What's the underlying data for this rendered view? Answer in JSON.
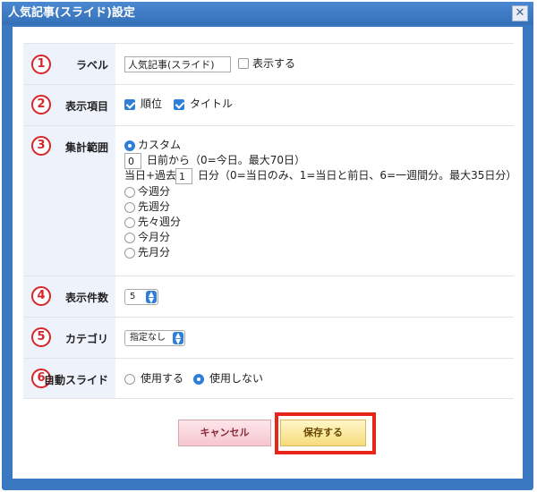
{
  "dialog": {
    "title": "人気記事(スライド)設定",
    "close_glyph": "✕"
  },
  "rows": {
    "label": {
      "num": "1",
      "label": "ラベル",
      "input_value": "人気記事(スライド)",
      "show_label": "表示する",
      "show_checked": false
    },
    "display_items": {
      "num": "2",
      "label": "表示項目",
      "options": [
        {
          "label": "順位",
          "checked": true
        },
        {
          "label": "タイトル",
          "checked": true
        }
      ]
    },
    "range": {
      "num": "3",
      "label": "集計範囲",
      "custom_label": "カスタム",
      "days_before_value": "0",
      "days_before_suffix": "日前から（0=今日。最大70日）",
      "past_prefix": "当日+過去",
      "past_value": "1",
      "past_suffix": "日分（0=当日のみ、1=当日と前日、6=一週間分。最大35日分）",
      "options": [
        "今週分",
        "先週分",
        "先々週分",
        "今月分",
        "先月分"
      ],
      "selected": "カスタム"
    },
    "count": {
      "num": "4",
      "label": "表示件数",
      "value": "5"
    },
    "category": {
      "num": "5",
      "label": "カテゴリ",
      "value": "指定なし"
    },
    "slide": {
      "num": "6",
      "label": "自動スライド",
      "options": [
        "使用する",
        "使用しない"
      ],
      "selected": "使用しない"
    }
  },
  "buttons": {
    "cancel": "キャンセル",
    "save": "保存する"
  },
  "colors": {
    "accent": "#2f7fd8",
    "titlebar": "#3b78c2",
    "marker": "#d8252a",
    "highlight": "#e8251b"
  }
}
